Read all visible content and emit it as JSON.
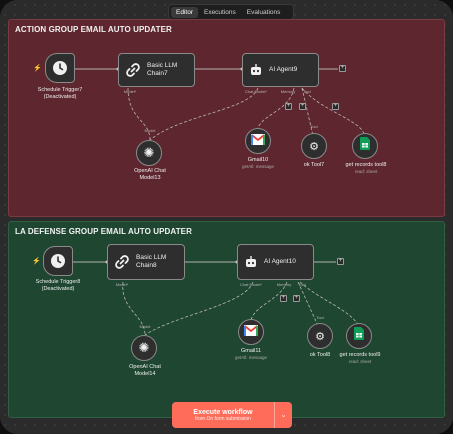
{
  "tabs": {
    "editor": "Editor",
    "executions": "Executions",
    "evaluations": "Evaluations"
  },
  "groups": {
    "red": {
      "title": "ACTION GROUP EMAIL AUTO UPDATER",
      "trigger": {
        "line1": "Schedule Trigger7",
        "line2": "(Deactivated)"
      },
      "chain": {
        "line1": "Basic LLM",
        "line2": "Chain7",
        "port": "Model*"
      },
      "agent": {
        "title": "AI Agent9",
        "port_model": "Chat Model*",
        "port_memory": "Memory",
        "port_tool": "Tool"
      },
      "model": {
        "port": "Model",
        "line1": "OpenAI Chat",
        "line2": "Model13"
      },
      "gmail": {
        "title": "Gmail10",
        "sub": "getAll: message"
      },
      "tool": {
        "port": "Tool",
        "title": "ok Tool7"
      },
      "sheet": {
        "title": "get records tool8",
        "sub": "read: sheet"
      }
    },
    "green": {
      "title": "LA DEFENSE GROUP EMAIL AUTO UPDATER",
      "trigger": {
        "line1": "Schedule Trigger8",
        "line2": "(Deactivated)"
      },
      "chain": {
        "line1": "Basic LLM",
        "line2": "Chain8",
        "port": "Model*"
      },
      "agent": {
        "title": "AI Agent10",
        "port_model": "Chat Model*",
        "port_memory": "Memory",
        "port_tool": "Tool"
      },
      "model": {
        "port": "Model",
        "line1": "OpenAI Chat",
        "line2": "Model14"
      },
      "gmail": {
        "title": "Gmail11",
        "sub": "getAll: message"
      },
      "tool": {
        "port": "Tool",
        "title": "ok Tool8"
      },
      "sheet": {
        "title": "get records tool9",
        "sub": "read: sheet"
      }
    }
  },
  "execute": {
    "title": "Execute workflow",
    "sub": "from On form submission"
  },
  "icons": {
    "trigger": "clock-icon",
    "chain": "chain-link-icon",
    "agent": "robot-icon",
    "model": "openai-icon",
    "gmail": "gmail-icon",
    "tool": "tool-icon",
    "sheet": "sheets-icon"
  },
  "colors": {
    "red_group": "#5e262e",
    "green_group": "#1f4631",
    "accent": "#ff6d5a"
  }
}
